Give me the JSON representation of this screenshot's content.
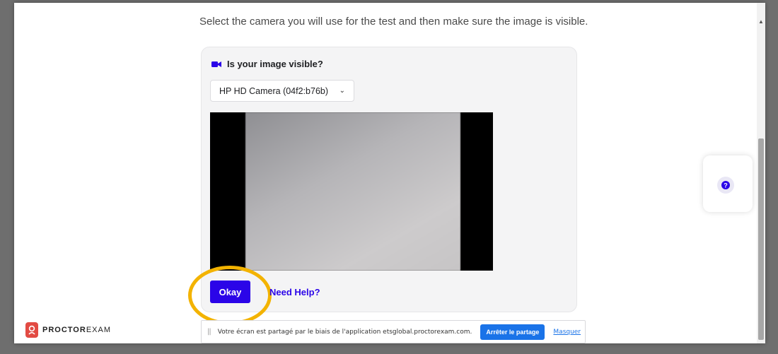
{
  "page": {
    "instruction": "Select the camera you will use for the test and then make sure the image is visible."
  },
  "card": {
    "title": "Is your image visible?",
    "camera_select": {
      "selected": "HP HD Camera (04f2:b76b)"
    },
    "okay_label": "Okay",
    "help_label": "Need Help?"
  },
  "floating_help": {
    "icon": "question-circle-icon"
  },
  "logo": {
    "strong": "PROCTOR",
    "light": "EXAM"
  },
  "share_bar": {
    "text": "Votre écran est partagé par le biais de l'application etsglobal.proctorexam.com.",
    "stop_label": "Arrêter le partage",
    "hide_label": "Masquer"
  },
  "colors": {
    "accent": "#2b05e8",
    "highlight": "#f3b300",
    "share_button": "#1a73e8",
    "logo_red": "#e24b43"
  }
}
